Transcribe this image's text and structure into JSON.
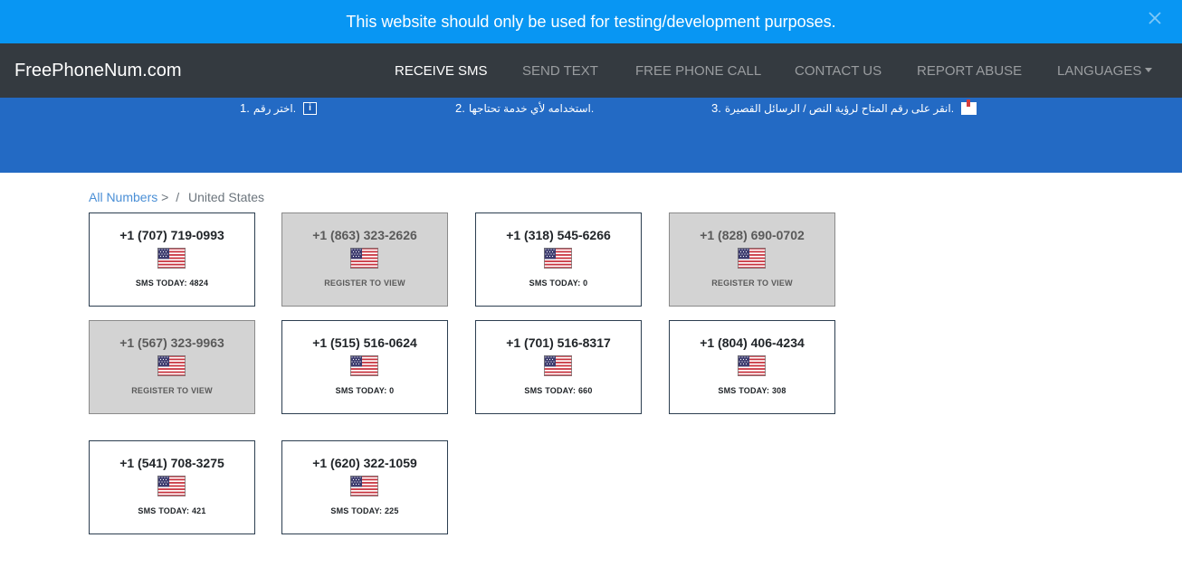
{
  "banner": {
    "text": "This website should only be used for testing/development purposes."
  },
  "nav": {
    "brand": "FreePhoneNum.com",
    "items": [
      "RECEIVE SMS",
      "SEND TEXT",
      "FREE PHONE CALL",
      "CONTACT US",
      "REPORT ABUSE",
      "LANGUAGES"
    ]
  },
  "hero": {
    "steps": [
      {
        "num": "1.",
        "text": ".اختر رقم"
      },
      {
        "num": "2.",
        "text": ".استخدامه لأي خدمة تحتاجها"
      },
      {
        "num": "3.",
        "text": ".انقر على رقم المتاح لرؤية النص / الرسائل القصيرة"
      }
    ]
  },
  "breadcrumb": {
    "link": "All Numbers",
    "arrow": ">",
    "slash": "/",
    "current": "United States"
  },
  "cards": [
    {
      "number": "+1 (707) 719-0993",
      "meta": "SMS TODAY: 4824",
      "locked": false
    },
    {
      "number": "+1 (863) 323-2626",
      "meta": "REGISTER TO VIEW",
      "locked": true
    },
    {
      "number": "+1 (318) 545-6266",
      "meta": "SMS TODAY: 0",
      "locked": false
    },
    {
      "number": "+1 (828) 690-0702",
      "meta": "REGISTER TO VIEW",
      "locked": true
    },
    {
      "number": "+1 (567) 323-9963",
      "meta": "REGISTER TO VIEW",
      "locked": true
    },
    {
      "number": "+1 (515) 516-0624",
      "meta": "SMS TODAY: 0",
      "locked": false
    },
    {
      "number": "+1 (701) 516-8317",
      "meta": "SMS TODAY: 660",
      "locked": false
    },
    {
      "number": "+1 (804) 406-4234",
      "meta": "SMS TODAY: 308",
      "locked": false
    },
    {
      "number": "+1 (541) 708-3275",
      "meta": "SMS TODAY: 421",
      "locked": false
    },
    {
      "number": "+1 (620) 322-1059",
      "meta": "SMS TODAY: 225",
      "locked": false
    }
  ],
  "colors": {
    "banner": "#0896f3",
    "navbar": "#343a40",
    "hero": "#236ac4",
    "link": "#4a8fd6"
  }
}
